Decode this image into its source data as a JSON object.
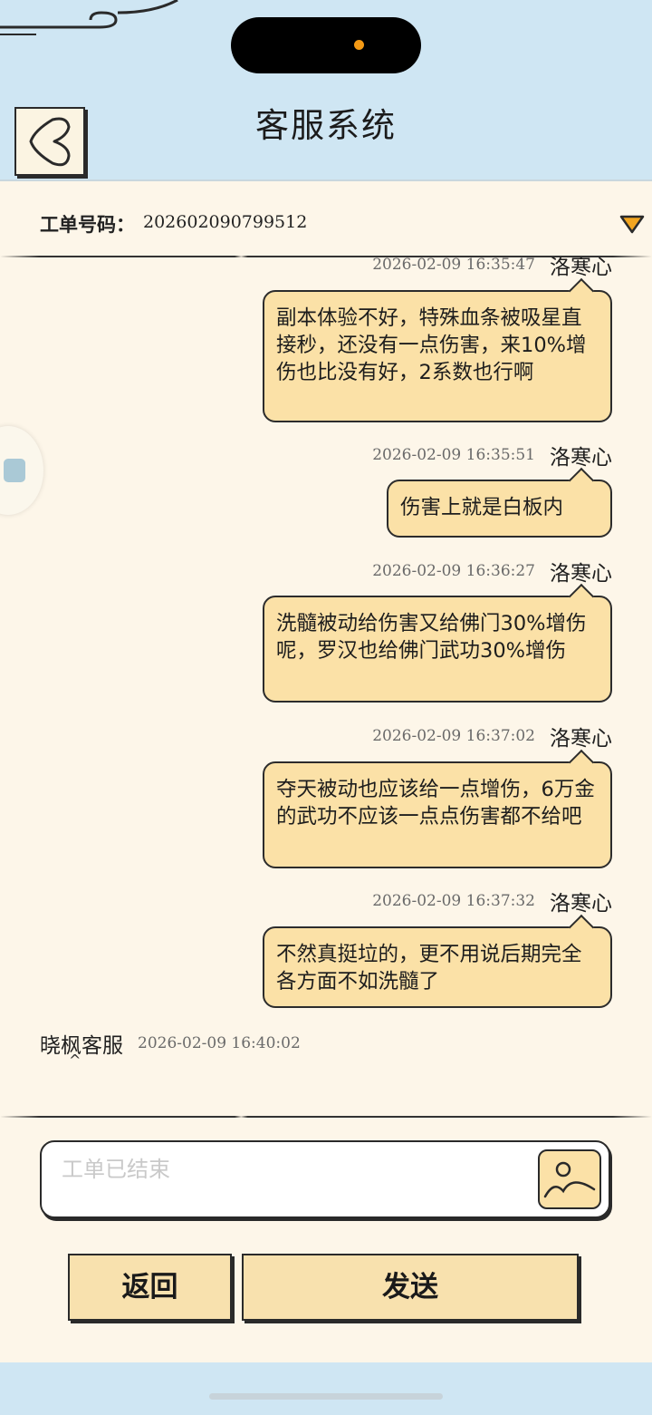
{
  "header": {
    "title": "客服系统",
    "back_icon": "back-chevron-icon"
  },
  "ticket": {
    "label": "工单号码：",
    "number": "202602090799512",
    "dropdown_icon": "triangle-down-icon"
  },
  "messages": [
    {
      "time": "2026-02-09 16:35:47",
      "sender": "洛寒心",
      "text": "副本体验不好，特殊血条被吸星直接秒，还没有一点伤害，来10%增伤也比没有好，2系数也行啊"
    },
    {
      "time": "2026-02-09 16:35:51",
      "sender": "洛寒心",
      "text": "伤害上就是白板内"
    },
    {
      "time": "2026-02-09 16:36:27",
      "sender": "洛寒心",
      "text": "洗髓被动给伤害又给佛门30%增伤呢，罗汉也给佛门武功30%增伤"
    },
    {
      "time": "2026-02-09 16:37:02",
      "sender": "洛寒心",
      "text": "夺天被动也应该给一点增伤，6万金的武功不应该一点点伤害都不给吧"
    },
    {
      "time": "2026-02-09 16:37:32",
      "sender": "洛寒心",
      "text": "不然真挺垃的，更不用说后期完全各方面不如洗髓了"
    }
  ],
  "reply": {
    "sender": "晓枫客服",
    "time": "2026-02-09 16:40:02",
    "caret": "^"
  },
  "input": {
    "placeholder": "工单已结束",
    "image_icon": "image-upload-icon"
  },
  "buttons": {
    "back": "返回",
    "send": "发送"
  },
  "colors": {
    "header_bg": "#cfe6f3",
    "page_bg": "#fdf6e9",
    "bubble_bg": "#fbe1a7",
    "button_bg": "#f8e1ae",
    "accent_orange": "#f59a14"
  }
}
